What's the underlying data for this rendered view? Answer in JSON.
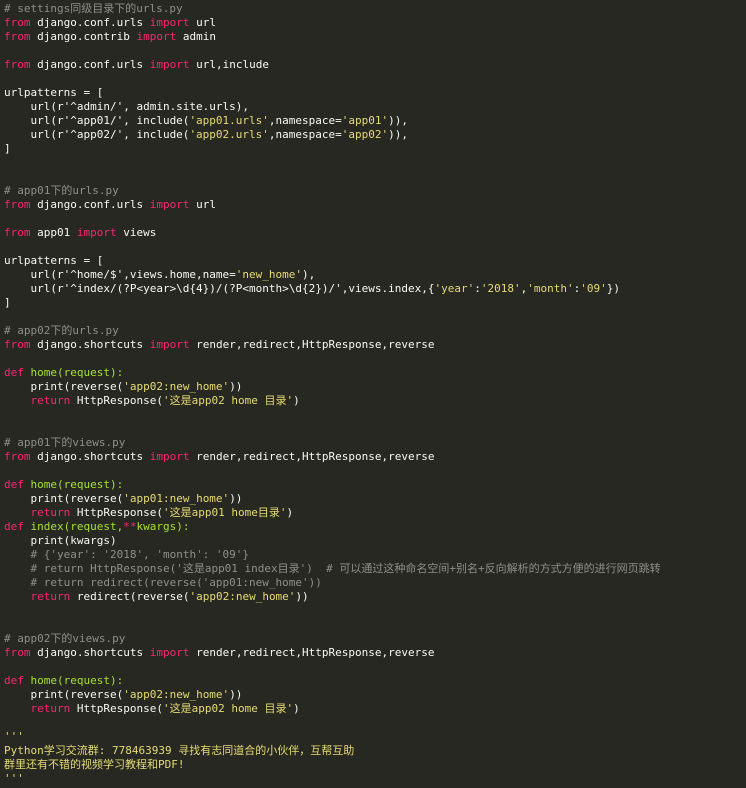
{
  "colors": {
    "background": "#272822",
    "plain": "#f8f8f2",
    "keyword": "#f92672",
    "function": "#a6e22e",
    "string": "#e6db74",
    "comment": "#8f8f88"
  },
  "code_lines": [
    [
      [
        "cm",
        "# settings同级目录下的urls.py"
      ]
    ],
    [
      [
        "kw",
        "from"
      ],
      [
        "pl",
        " django.conf.urls "
      ],
      [
        "kw",
        "import"
      ],
      [
        "pl",
        " url"
      ]
    ],
    [
      [
        "kw",
        "from"
      ],
      [
        "pl",
        " django.contrib "
      ],
      [
        "kw",
        "import"
      ],
      [
        "pl",
        " admin"
      ]
    ],
    [],
    [
      [
        "kw",
        "from"
      ],
      [
        "pl",
        " django.conf.urls "
      ],
      [
        "kw",
        "import"
      ],
      [
        "pl",
        " url,include"
      ]
    ],
    [],
    [
      [
        "pl",
        "urlpatterns = ["
      ]
    ],
    [
      [
        "pl",
        "    url(r'^admin/', admin.site.urls),"
      ]
    ],
    [
      [
        "pl",
        "    url(r'^app01/', include("
      ],
      [
        "str",
        "'app01.urls'"
      ],
      [
        "pl",
        ",namespace="
      ],
      [
        "str",
        "'app01'"
      ],
      [
        "pl",
        ")),"
      ]
    ],
    [
      [
        "pl",
        "    url(r'^app02/', include("
      ],
      [
        "str",
        "'app02.urls'"
      ],
      [
        "pl",
        ",namespace="
      ],
      [
        "str",
        "'app02'"
      ],
      [
        "pl",
        ")),"
      ]
    ],
    [
      [
        "pl",
        "]"
      ]
    ],
    [],
    [],
    [
      [
        "cm",
        "# app01下的urls.py"
      ]
    ],
    [
      [
        "kw",
        "from"
      ],
      [
        "pl",
        " django.conf.urls "
      ],
      [
        "kw",
        "import"
      ],
      [
        "pl",
        " url"
      ]
    ],
    [],
    [
      [
        "kw",
        "from"
      ],
      [
        "pl",
        " app01 "
      ],
      [
        "kw",
        "import"
      ],
      [
        "pl",
        " views"
      ]
    ],
    [],
    [
      [
        "pl",
        "urlpatterns = ["
      ]
    ],
    [
      [
        "pl",
        "    url(r'^home/$',views.home,name="
      ],
      [
        "str",
        "'new_home'"
      ],
      [
        "pl",
        "),"
      ]
    ],
    [
      [
        "pl",
        "    url(r'^index/(?P<year>\\d{4})/(?P<month>\\d{2})/',views.index,{"
      ],
      [
        "str",
        "'year'"
      ],
      [
        "pl",
        ":"
      ],
      [
        "str",
        "'2018'"
      ],
      [
        "pl",
        ","
      ],
      [
        "str",
        "'month'"
      ],
      [
        "pl",
        ":"
      ],
      [
        "str",
        "'09'"
      ],
      [
        "pl",
        "})"
      ]
    ],
    [
      [
        "pl",
        "]"
      ]
    ],
    [],
    [
      [
        "cm",
        "# app02下的urls.py"
      ]
    ],
    [
      [
        "kw",
        "from"
      ],
      [
        "pl",
        " django.shortcuts "
      ],
      [
        "kw",
        "import"
      ],
      [
        "pl",
        " render,redirect,HttpResponse,reverse"
      ]
    ],
    [],
    [
      [
        "kw",
        "def"
      ],
      [
        "pl",
        " "
      ],
      [
        "fn",
        "home(request):"
      ]
    ],
    [
      [
        "pl",
        "    print(reverse("
      ],
      [
        "str",
        "'app02:new_home'"
      ],
      [
        "pl",
        "))"
      ]
    ],
    [
      [
        "pl",
        "    "
      ],
      [
        "kw",
        "return"
      ],
      [
        "pl",
        " HttpResponse("
      ],
      [
        "str",
        "'这是app02 home 目录'"
      ],
      [
        "pl",
        ")"
      ]
    ],
    [],
    [],
    [
      [
        "cm",
        "# app01下的views.py"
      ]
    ],
    [
      [
        "kw",
        "from"
      ],
      [
        "pl",
        " django.shortcuts "
      ],
      [
        "kw",
        "import"
      ],
      [
        "pl",
        " render,redirect,HttpResponse,reverse"
      ]
    ],
    [],
    [
      [
        "kw",
        "def"
      ],
      [
        "pl",
        " "
      ],
      [
        "fn",
        "home(request):"
      ]
    ],
    [
      [
        "pl",
        "    print(reverse("
      ],
      [
        "str",
        "'app01:new_home'"
      ],
      [
        "pl",
        "))"
      ]
    ],
    [
      [
        "pl",
        "    "
      ],
      [
        "kw",
        "return"
      ],
      [
        "pl",
        " HttpResponse("
      ],
      [
        "str",
        "'这是app01 home目录'"
      ],
      [
        "pl",
        ")"
      ]
    ],
    [
      [
        "kw",
        "def"
      ],
      [
        "pl",
        " "
      ],
      [
        "fn",
        "index(request,"
      ],
      [
        "kw",
        "**"
      ],
      [
        "fn",
        "kwargs):"
      ]
    ],
    [
      [
        "pl",
        "    print(kwargs)"
      ]
    ],
    [
      [
        "pl",
        "    "
      ],
      [
        "cm",
        "# {'year': '2018', 'month': '09'}"
      ]
    ],
    [
      [
        "pl",
        "    "
      ],
      [
        "cm",
        "# return HttpResponse('这是app01 index目录')  # 可以通过这种命名空间+别名+反向解析的方式方便的进行网页跳转"
      ]
    ],
    [
      [
        "pl",
        "    "
      ],
      [
        "cm",
        "# return redirect(reverse('app01:new_home'))"
      ]
    ],
    [
      [
        "pl",
        "    "
      ],
      [
        "kw",
        "return"
      ],
      [
        "pl",
        " redirect(reverse("
      ],
      [
        "str",
        "'app02:new_home'"
      ],
      [
        "pl",
        "))"
      ]
    ],
    [],
    [],
    [
      [
        "cm",
        "# app02下的views.py"
      ]
    ],
    [
      [
        "kw",
        "from"
      ],
      [
        "pl",
        " django.shortcuts "
      ],
      [
        "kw",
        "import"
      ],
      [
        "pl",
        " render,redirect,HttpResponse,reverse"
      ]
    ],
    [],
    [
      [
        "kw",
        "def"
      ],
      [
        "pl",
        " "
      ],
      [
        "fn",
        "home(request):"
      ]
    ],
    [
      [
        "pl",
        "    print(reverse("
      ],
      [
        "str",
        "'app02:new_home'"
      ],
      [
        "pl",
        "))"
      ]
    ],
    [
      [
        "pl",
        "    "
      ],
      [
        "kw",
        "return"
      ],
      [
        "pl",
        " HttpResponse("
      ],
      [
        "str",
        "'这是app02 home 目录'"
      ],
      [
        "pl",
        ")"
      ]
    ],
    [],
    [
      [
        "str",
        "'''"
      ]
    ],
    [
      [
        "str",
        "Python学习交流群: 778463939 寻找有志同道合的小伙伴，互帮互助"
      ]
    ],
    [
      [
        "str",
        "群里还有不错的视频学习教程和PDF!"
      ]
    ],
    [
      [
        "str",
        "'''"
      ]
    ]
  ]
}
